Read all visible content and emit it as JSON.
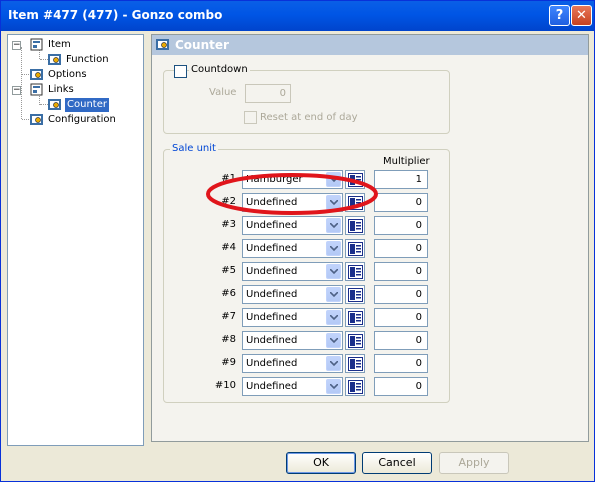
{
  "window": {
    "title": "Item #477 (477) - Gonzo combo",
    "help_glyph": "?",
    "close_glyph": "✕"
  },
  "tree": {
    "nodes": [
      {
        "label": "Item",
        "expander": "−"
      },
      {
        "label": "Function"
      },
      {
        "label": "Options"
      },
      {
        "label": "Links",
        "expander": "−"
      },
      {
        "label": "Counter"
      },
      {
        "label": "Configuration"
      }
    ]
  },
  "panel": {
    "title": "Counter",
    "countdown": {
      "label": "Countdown",
      "checked": false,
      "value_label": "Value",
      "value": "0",
      "reset_label": "Reset at end of day"
    },
    "sale_unit": {
      "label": "Sale unit",
      "multiplier_header": "Multiplier",
      "rows": [
        {
          "num": "#1",
          "value": "Hamburger",
          "multiplier": "1"
        },
        {
          "num": "#2",
          "value": "Undefined",
          "multiplier": "0"
        },
        {
          "num": "#3",
          "value": "Undefined",
          "multiplier": "0"
        },
        {
          "num": "#4",
          "value": "Undefined",
          "multiplier": "0"
        },
        {
          "num": "#5",
          "value": "Undefined",
          "multiplier": "0"
        },
        {
          "num": "#6",
          "value": "Undefined",
          "multiplier": "0"
        },
        {
          "num": "#7",
          "value": "Undefined",
          "multiplier": "0"
        },
        {
          "num": "#8",
          "value": "Undefined",
          "multiplier": "0"
        },
        {
          "num": "#9",
          "value": "Undefined",
          "multiplier": "0"
        },
        {
          "num": "#10",
          "value": "Undefined",
          "multiplier": "0"
        }
      ]
    }
  },
  "buttons": {
    "ok": "OK",
    "cancel": "Cancel",
    "apply": "Apply"
  },
  "colors": {
    "title_bar": "#0055e5",
    "selection": "#316ac5",
    "highlight_ring": "#e0151b",
    "group_label": "#0046d5"
  }
}
